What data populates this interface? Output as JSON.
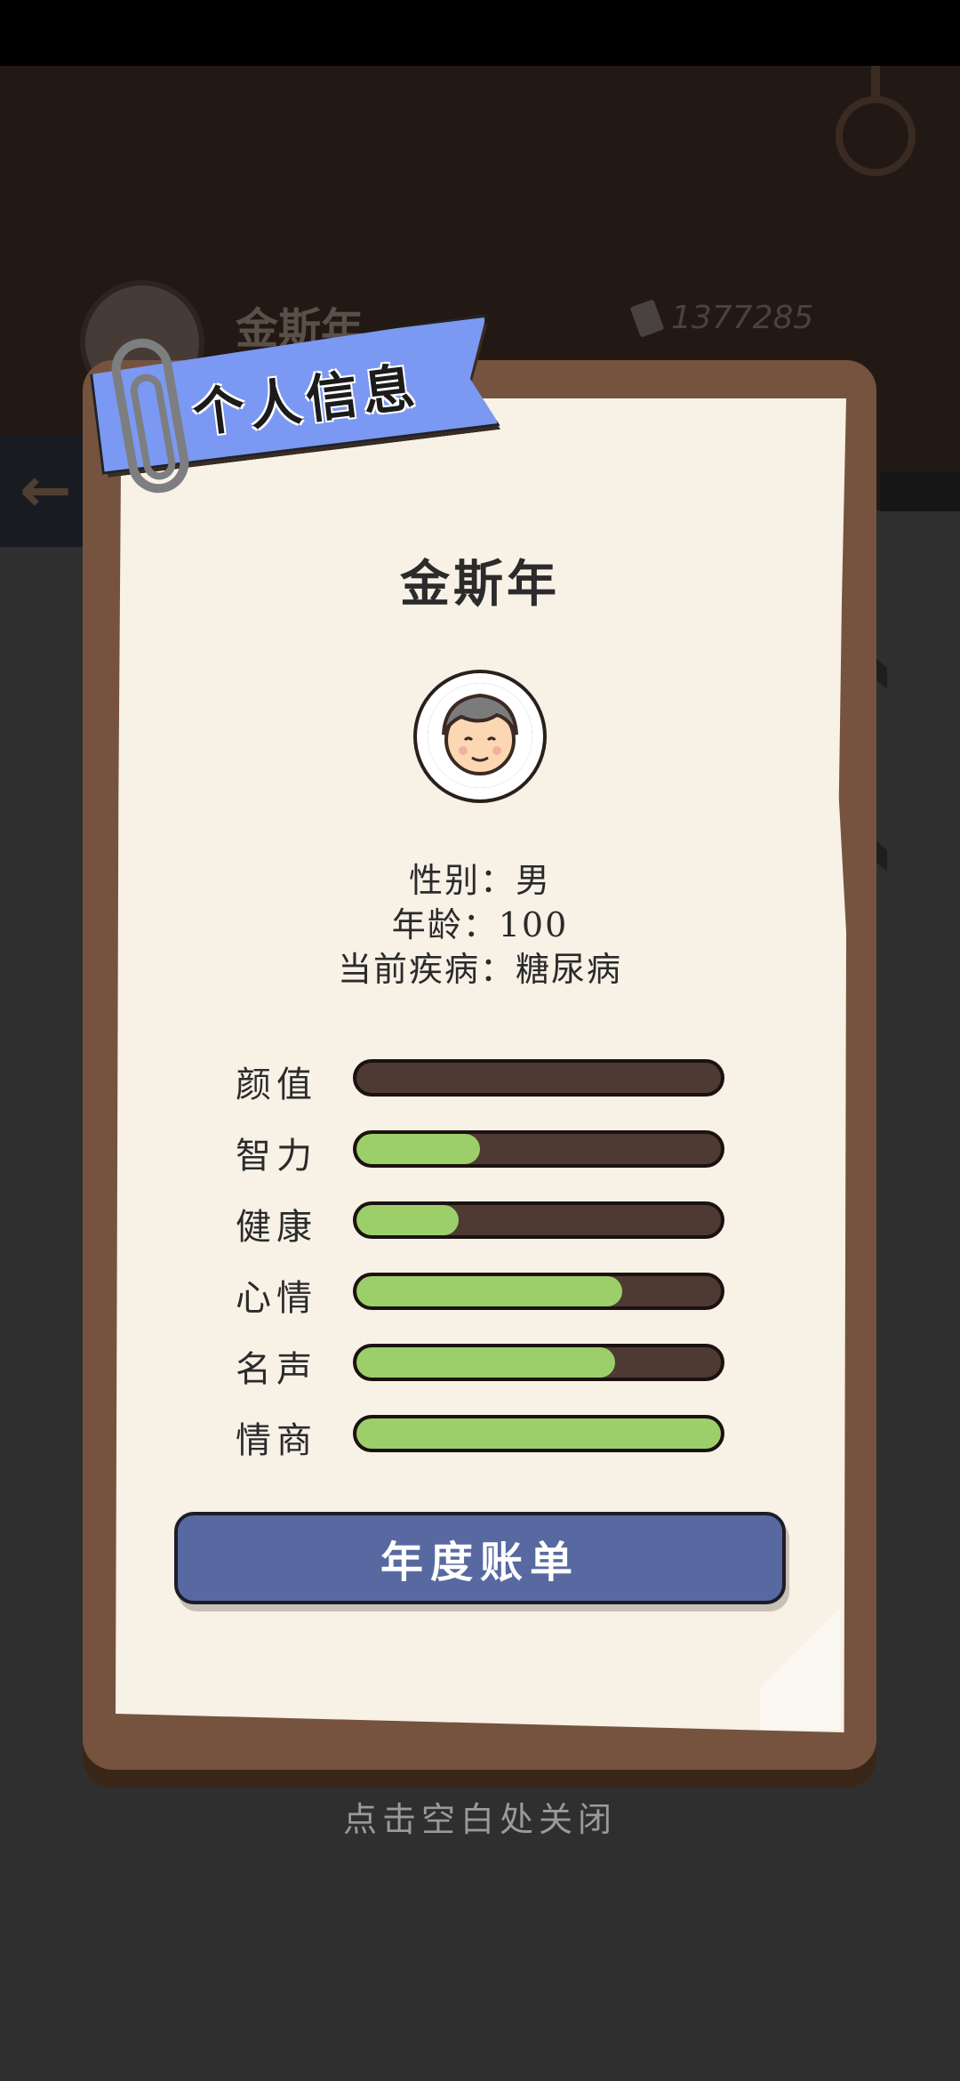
{
  "background": {
    "player_name": "金斯年",
    "coins": "1377285",
    "back_icon": "back-arrow-icon",
    "coin_icon": "coin-icon"
  },
  "modal": {
    "ribbon_title": "个人信息",
    "name": "金斯年",
    "avatar": "elderly-man-avatar",
    "info": {
      "gender": "性别：男",
      "age": "年龄：100",
      "disease": "当前疾病：糖尿病"
    },
    "stats": [
      {
        "label": "颜值",
        "value": 0
      },
      {
        "label": "智力",
        "value": 0.34
      },
      {
        "label": "健康",
        "value": 0.28
      },
      {
        "label": "心情",
        "value": 0.73
      },
      {
        "label": "名声",
        "value": 0.71
      },
      {
        "label": "情商",
        "value": 1.0
      }
    ],
    "bill_button": "年度账单",
    "close_hint": "点击空白处关闭"
  },
  "colors": {
    "ribbon": "#7b99f2",
    "board": "#75533f",
    "paper": "#f7f1e6",
    "stat_fill": "#9ccf6a",
    "stat_track": "#4e3a33",
    "button": "#5769a0"
  }
}
